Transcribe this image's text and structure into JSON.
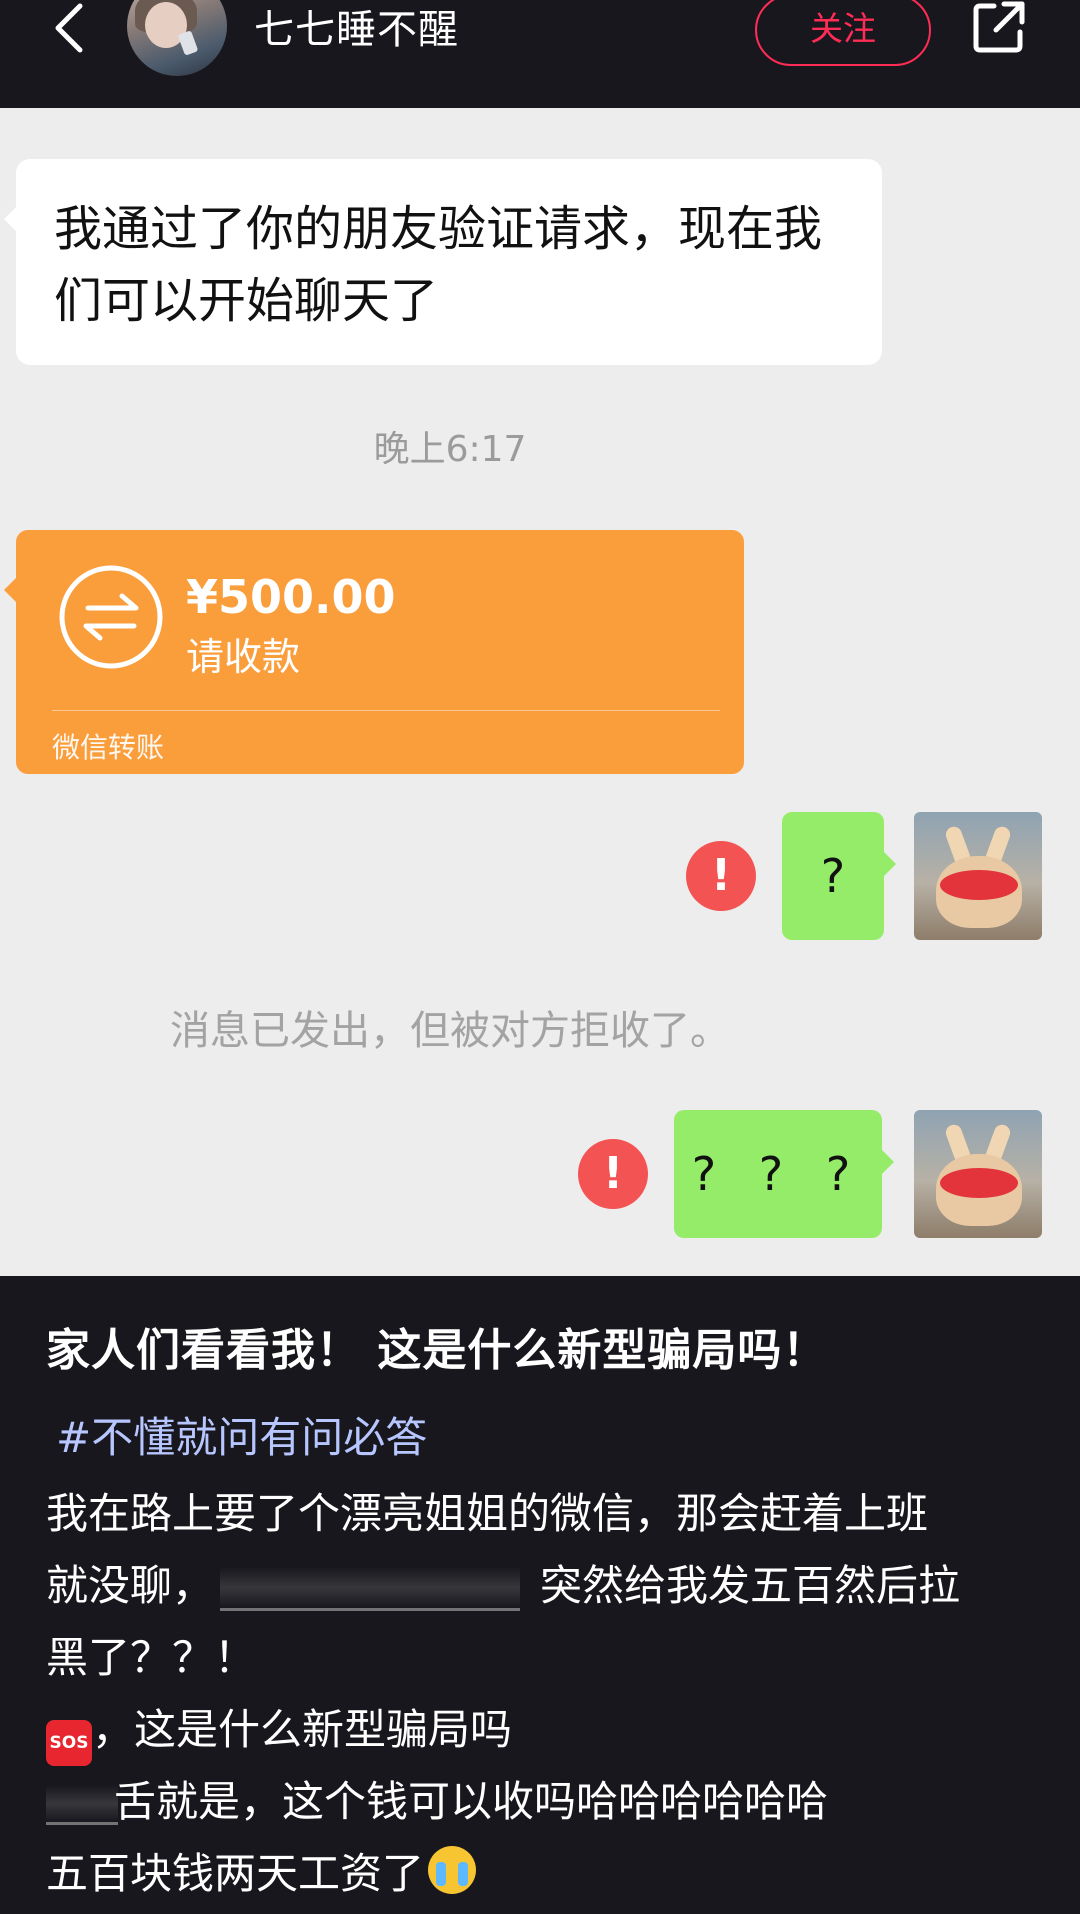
{
  "header": {
    "username": "七七睡不醒",
    "follow_label": "关注",
    "icons": {
      "back": "chevron-left-icon",
      "share": "share-external-icon"
    }
  },
  "chat": {
    "received_message": "我通过了你的朋友验证请求，现在我们可以开始聊天了",
    "time": "晚上6:17",
    "transfer": {
      "amount": "¥500.00",
      "status": "请收款",
      "label": "微信转账",
      "color": "#fa9d3b"
    },
    "sent_messages": [
      "?",
      "? ? ?"
    ],
    "error_mark": "!",
    "rejected_notice": "消息已发出，但被对方拒收了。",
    "colors": {
      "sent_bubble": "#95ec69",
      "error": "#f45353",
      "background": "#ededed"
    }
  },
  "post": {
    "title": "家人们看看我！ 这是什么新型骗局吗！",
    "hashtag": "#不懂就问有问必答",
    "line1": "我在路上要了个漂亮姐姐的微信，那会赶着上班",
    "line2_a": "就没聊，",
    "line2_b": "突然给我发五百然后拉",
    "line3": "黑了？？！",
    "line4_emoji": "SOS",
    "line4_text": "，这是什么新型骗局吗",
    "line5": "舌就是，这个钱可以收吗哈哈哈哈哈哈",
    "line6": "五百块钱两天工资了",
    "emoji_names": [
      "sos-icon",
      "loudly-crying-face-icon"
    ]
  }
}
